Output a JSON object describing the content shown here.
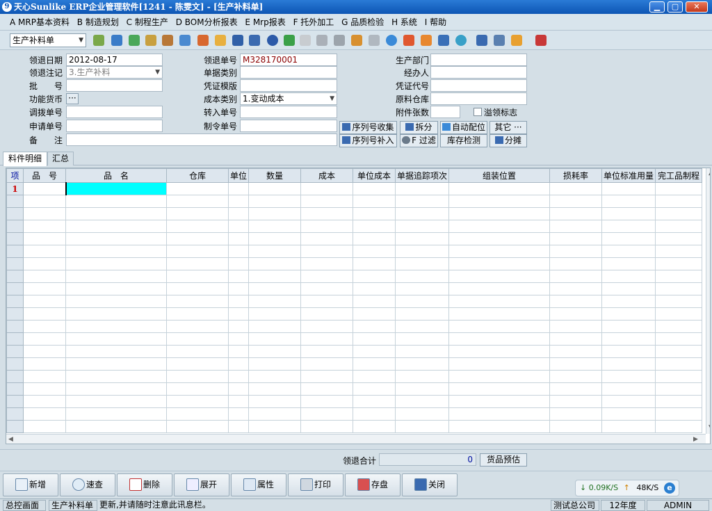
{
  "window": {
    "title": "天心Sunlike ERP企业管理软件[1241 - 陈雯文] - [生产补料单]",
    "min": "▁",
    "max": "▢",
    "close": "✕"
  },
  "menu": [
    "A MRP基本资料",
    "B 制造规划",
    "C 制程生产",
    "D BOM分析报表",
    "E Mrp报表",
    "F 托外加工",
    "G 品质检验",
    "H 系统",
    "I 帮助"
  ],
  "toolbar": {
    "doc_type": "生产补料单"
  },
  "form": {
    "l_date": "领退日期",
    "date": "2012-08-17",
    "l_note": "领退注记",
    "note": "3.生产补料",
    "l_batch": "批　　号",
    "batch": "",
    "l_currency": "功能货币",
    "currency_btn": "···",
    "l_transfer": "调拨单号",
    "transfer": "",
    "l_apply": "申请单号",
    "apply": "",
    "l_remark": "备　　注",
    "remark": "",
    "l_no": "领退单号",
    "no": "M328170001",
    "l_doc_type": "单据类别",
    "doc_type": "",
    "l_voucher_tpl": "凭证模版",
    "voucher_tpl": "",
    "l_cost_type": "成本类别",
    "cost_type": "1.变动成本",
    "l_in_no": "转入单号",
    "in_no": "",
    "l_order_no": "制令单号",
    "order_no": "",
    "l_dept": "生产部门",
    "dept": "",
    "l_handler": "经办人",
    "handler": "",
    "l_voucher_code": "凭证代号",
    "voucher_code": "",
    "l_warehouse": "原料仓库",
    "warehouse": "",
    "l_attach": "附件张数",
    "attach": "",
    "l_over": "溢领标志"
  },
  "buttons": {
    "serial_collect": "序列号收集",
    "split": "拆分",
    "auto_alloc": "自动配位",
    "other": "其它 ···",
    "serial_supplement": "序列号补入",
    "filter": "F 过滤",
    "stock_check": "库存检测",
    "apportion": "分摊"
  },
  "tabs": [
    "料件明细",
    "汇总"
  ],
  "grid": {
    "columns": [
      "项",
      "品　号",
      "品　名",
      "仓库",
      "单位",
      "数量",
      "成本",
      "单位成本",
      "单据追踪项次",
      "组装位置",
      "损耗率",
      "单位标准用量",
      "完工品制程"
    ],
    "first_row": "1"
  },
  "summary": {
    "label": "领退合计",
    "value": "0",
    "preview": "货品预估"
  },
  "actions": [
    "新增",
    "速查",
    "删除",
    "展开",
    "属性",
    "打印",
    "存盘",
    "关闭"
  ],
  "net": {
    "down": "↓ 0.09K/S",
    "up": "↑",
    "up_val": "48K/S",
    "ie": "e"
  },
  "status": {
    "home": "总控画面",
    "current": "生产补料单",
    "message": "更新,并请随时注意此讯息栏。",
    "company": "测试总公司",
    "year": "12年度",
    "user": "ADMIN"
  },
  "colors": {
    "title": "#0d55b4",
    "selected_cell": "#00ffff",
    "row_number": "#cc0000"
  }
}
